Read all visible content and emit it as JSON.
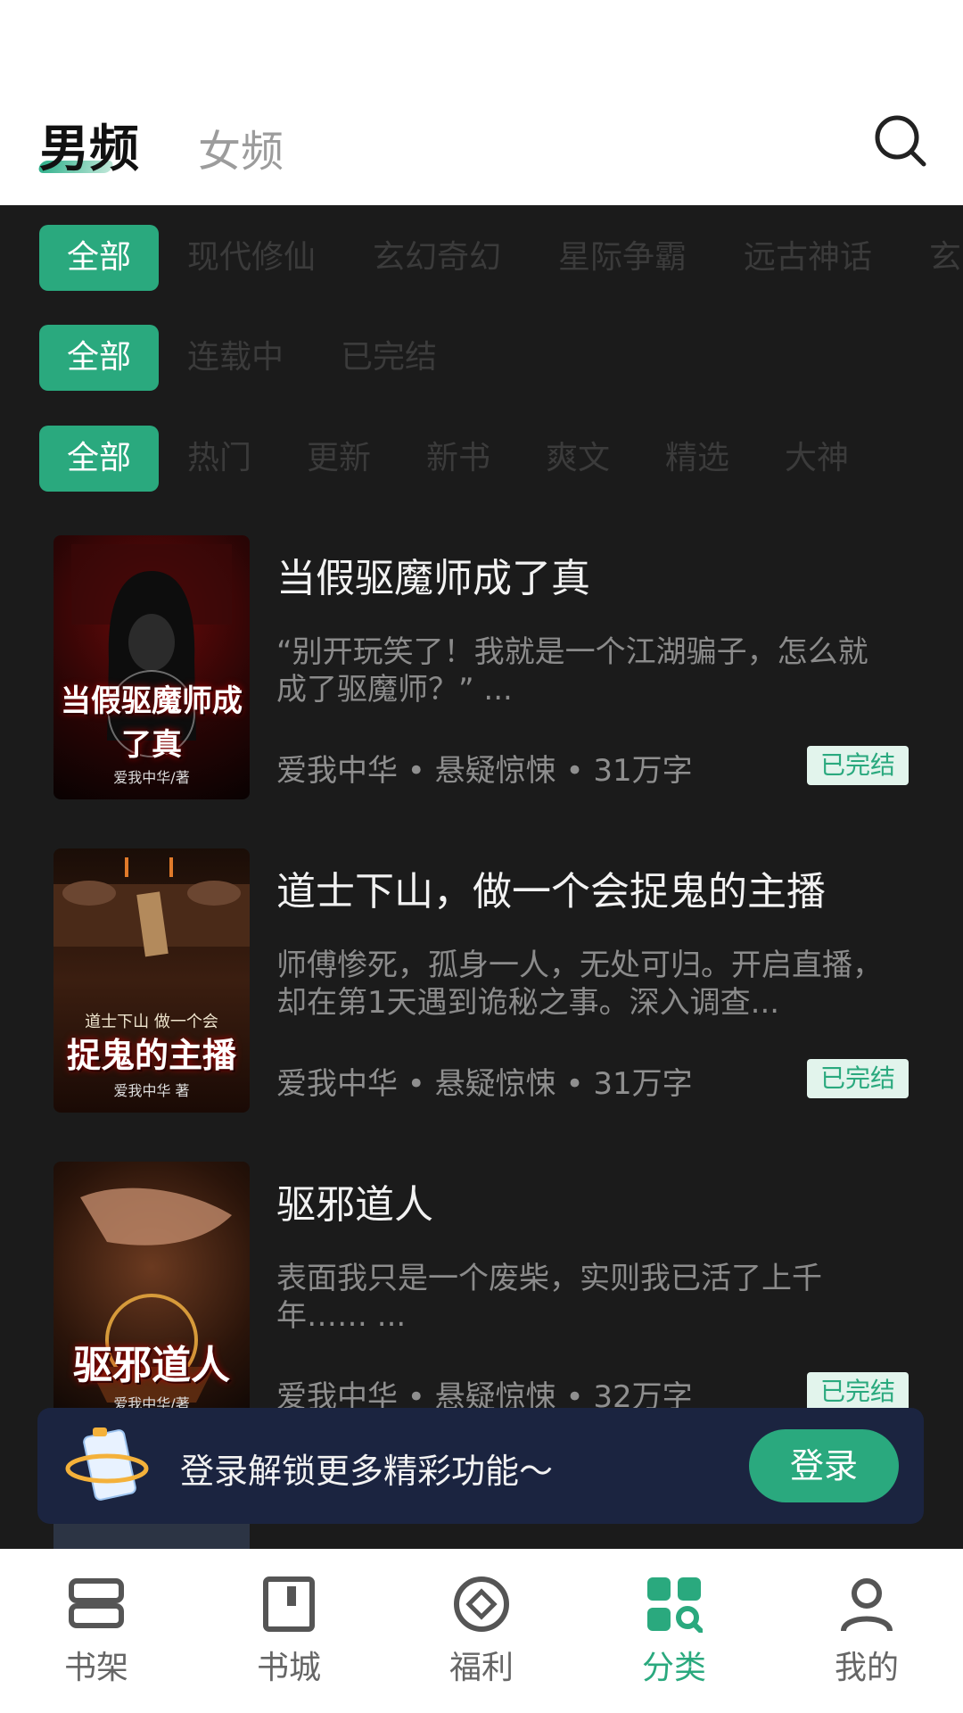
{
  "header": {
    "tab_male": "男频",
    "tab_female": "女频",
    "search_icon": "search-icon"
  },
  "filters": {
    "genre": {
      "active": "全部",
      "items": [
        "现代修仙",
        "玄幻奇幻",
        "星际争霸",
        "远古神话",
        "玄"
      ]
    },
    "status": {
      "active": "全部",
      "items": [
        "连载中",
        "已完结"
      ]
    },
    "sort": {
      "active": "全部",
      "items": [
        "热门",
        "更新",
        "新书",
        "爽文",
        "精选",
        "大神"
      ]
    }
  },
  "books": [
    {
      "title": "当假驱魔师成了真",
      "description": "“别开玩笑了！我就是一个江湖骗子，怎么就成了驱魔师？” ...",
      "meta": "爱我中华 • 悬疑惊悚 • 31万字",
      "status": "已完结",
      "cover_title": "当假驱魔师成了真",
      "cover_author": "爱我中华/著"
    },
    {
      "title": "道士下山，做一个会捉鬼的主播",
      "description": "师傅惨死，孤身一人，无处可归。开启直播，却在第1天遇到诡秘之事。深入调查...",
      "meta": "爱我中华 • 悬疑惊悚 • 31万字",
      "status": "已完结",
      "cover_sub": "道士下山 做一个会",
      "cover_title": "捉鬼的主播",
      "cover_author": "爱我中华 著"
    },
    {
      "title": "驱邪道人",
      "description": "表面我只是一个废柴，实则我已活了上千年…… ...",
      "meta": "爱我中华 • 悬疑惊悚 • 32万字",
      "status": "已完结",
      "cover_title": "驱邪道人",
      "cover_author": "爱我中华/著"
    }
  ],
  "login_banner": {
    "text": "登录解锁更多精彩功能～",
    "button": "登录"
  },
  "bottom_nav": [
    {
      "label": "书架",
      "icon": "bookshelf-icon",
      "active": false
    },
    {
      "label": "书城",
      "icon": "bookstore-icon",
      "active": false
    },
    {
      "label": "福利",
      "icon": "welfare-icon",
      "active": false
    },
    {
      "label": "分类",
      "icon": "category-icon",
      "active": true
    },
    {
      "label": "我的",
      "icon": "profile-icon",
      "active": false
    }
  ],
  "colors": {
    "accent": "#2aa97e",
    "background": "#1b1b1b",
    "banner": "#1b2440"
  }
}
